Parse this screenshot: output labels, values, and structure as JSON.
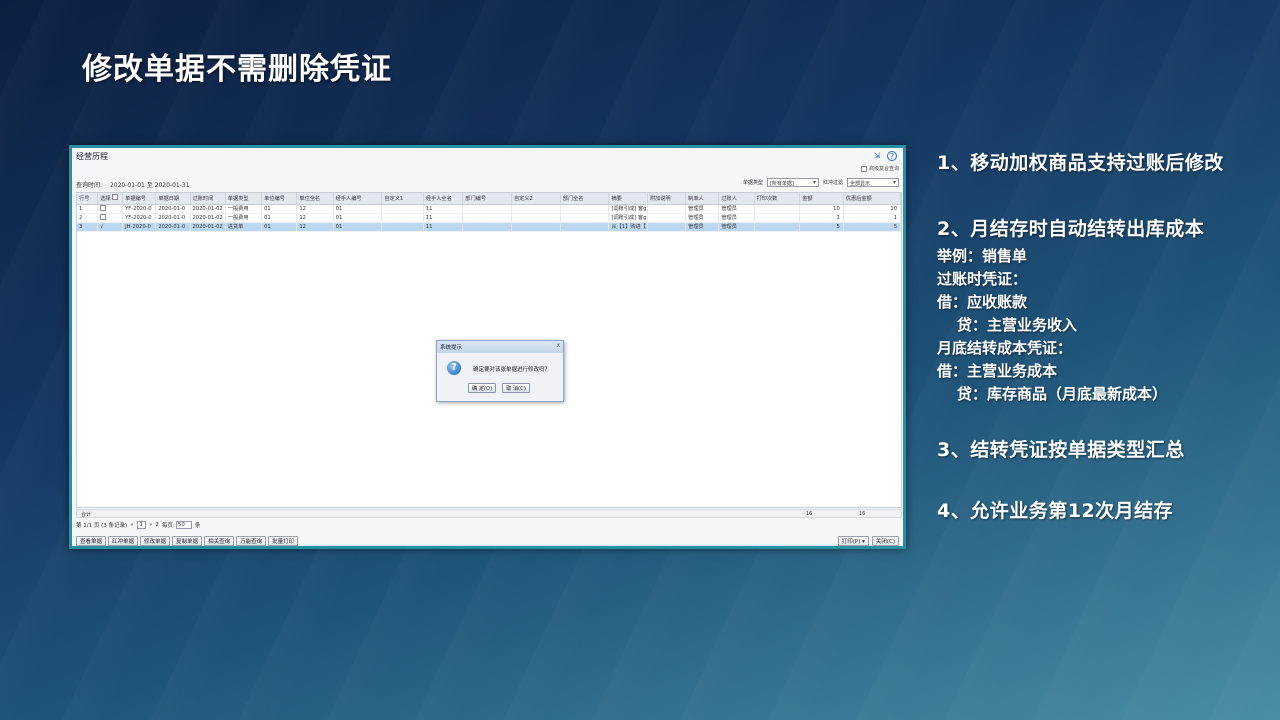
{
  "slide": {
    "title": "修改单据不需删除凭证",
    "notes": {
      "n1": "1、移动加权商品支持过账后修改",
      "n2": "2、月结存时自动结转出库成本",
      "lines": [
        "举例：销售单",
        "过账时凭证：",
        "借：应收账款",
        "贷：主营业务收入",
        "月底结转成本凭证：",
        "借：主营业务成本",
        "贷：库存商品（月底最新成本）"
      ],
      "n3": "3、结转凭证按单据类型汇总",
      "n4": "4、允许业务第12次月结存"
    }
  },
  "app": {
    "title": "经营历程",
    "option_label": "高级复合查询",
    "query_label": "查询时间:",
    "query_range": "2020-01-01 至 2020-01-31",
    "doc_type_label": "单据类型",
    "doc_type_value": "[所有单据]",
    "red_label": "红冲过滤",
    "red_value": "全部显示",
    "columns": [
      "行号",
      "选择",
      "单据编号",
      "单据日期",
      "过账时间",
      "单据类型",
      "单位编号",
      "单位全名",
      "经手人编号",
      "自定义1",
      "经手人全名",
      "部门编号",
      "自定义2",
      "部门全名",
      "摘要",
      "附加说明",
      "制单人",
      "过账人",
      "打印次数",
      "金额",
      "优惠后金额"
    ],
    "rows": [
      [
        "1",
        "",
        "YF-2020-0",
        "2020-01-0",
        "2020-01-02",
        "一般费用",
        "01",
        "12",
        "01",
        "",
        "11",
        "",
        "",
        "",
        "[调账引成] 客g",
        "",
        "管理员",
        "管理员",
        "",
        "10",
        "10"
      ],
      [
        "2",
        "",
        "YF-2020-0",
        "2020-01-0",
        "2020-01-02",
        "一般费用",
        "01",
        "12",
        "01",
        "",
        "11",
        "",
        "",
        "",
        "[调账引成] 客g",
        "",
        "管理员",
        "管理员",
        "",
        "1",
        "1"
      ],
      [
        "3",
        "√",
        "JH-2020-0",
        "2020-01-0",
        "2020-01-02",
        "进货单",
        "01",
        "12",
        "01",
        "",
        "11",
        "",
        "",
        "",
        "从【1】购进【",
        "",
        "管理员",
        "管理员",
        "",
        "5",
        "5"
      ]
    ],
    "total_label": "合计",
    "total_amount": "16",
    "total_discount": "16",
    "pager": {
      "info": "第 1/1 页 (3 条记录)",
      "prev": "«",
      "current": "1",
      "next": "»",
      "page_num": "2",
      "page_size_label": "每页",
      "page_size": "50",
      "unit": "条"
    },
    "buttons": [
      "查看单据",
      "红冲单据",
      "修改单据",
      "复制单据",
      "相关查询",
      "万能查询",
      "批量打印"
    ],
    "print_button": "打印(P) ▾",
    "close_button": "关闭(C)",
    "dialog": {
      "title": "系统提示",
      "close": "x",
      "message": "确定要对该张单据进行修改吗？",
      "ok": "确 定(O)",
      "cancel": "取 消(C)"
    }
  }
}
